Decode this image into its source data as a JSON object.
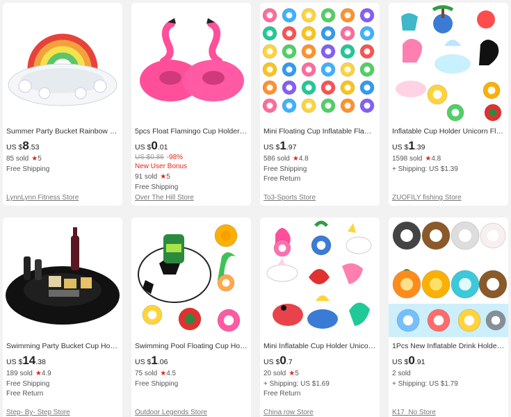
{
  "products": [
    {
      "title": "Summer Party Bucket Rainbow Clo...",
      "currency": "US $",
      "price_int": "8",
      "price_dec": ".53",
      "sold": "85 sold",
      "rating": "5",
      "shipping": "Free Shipping",
      "ret": "",
      "store": "LynnLynn Fitness Store",
      "image": "rainbow-bucket"
    },
    {
      "title": "5pcs Float Flamingo Cup Holder C...",
      "currency": "US $",
      "price_int": "0",
      "price_dec": ".01",
      "old_price": "US $0.86",
      "discount": "-98%",
      "bonus": "New User Bonus",
      "sold": "91 sold",
      "rating": "5",
      "shipping": "Free Shipping",
      "ret": "",
      "store": "Over The Hill Store",
      "image": "pink-flamingo"
    },
    {
      "title": "Mini Floating Cup Inflatable Flamin...",
      "currency": "US $",
      "price_int": "1",
      "price_dec": ".97",
      "sold": "586 sold",
      "rating": "4.8",
      "shipping": "Free Shipping",
      "ret": "Free Return",
      "store": "To3-Sports Store",
      "image": "mini-float-grid"
    },
    {
      "title": "Inflatable Cup Holder Unicorn Fla...",
      "currency": "US $",
      "price_int": "1",
      "price_dec": ".39",
      "sold": "1598 sold",
      "rating": "4.8",
      "shipping": "+ Shipping: US $1.39",
      "ret": "",
      "store": "ZUOFILY fishing Store",
      "image": "unicorn-set"
    },
    {
      "title": "Swimming Party Bucket Cup Holde...",
      "currency": "US $",
      "price_int": "14",
      "price_dec": ".38",
      "sold": "189 sold",
      "rating": "4.9",
      "shipping": "Free Shipping",
      "ret": "Free Return",
      "store": "Step- By- Step Store",
      "image": "black-bucket"
    },
    {
      "title": "Swimming Pool Floating Cup Hold...",
      "currency": "US $",
      "price_int": "1",
      "price_dec": ".06",
      "sold": "75 sold",
      "rating": "4.5",
      "shipping": "Free Shipping",
      "ret": "",
      "store": "Outdoor Legends Store",
      "image": "soccer-float"
    },
    {
      "title": "Mini Inflatable Cup Holder Unicorn...",
      "currency": "US $",
      "price_int": "0",
      "price_dec": ".7",
      "sold": "20 sold",
      "rating": "5",
      "shipping": "+ Shipping: US $1.69",
      "ret": "Free Return",
      "store": "China row Store",
      "image": "mini-animals"
    },
    {
      "title": "1Pcs New Inflatable Drink Holder S...",
      "currency": "US $",
      "price_int": "0",
      "price_dec": ".91",
      "sold": "2 sold",
      "rating": "",
      "shipping": "+ Shipping: US $1.79",
      "ret": "",
      "store": "K17_No Store",
      "image": "animal-rings"
    }
  ],
  "colors": {
    "accent": "#e1251b",
    "text": "#333333",
    "muted": "#999999",
    "background": "#f2f2f2"
  },
  "icons": {
    "rating": "star-icon"
  }
}
